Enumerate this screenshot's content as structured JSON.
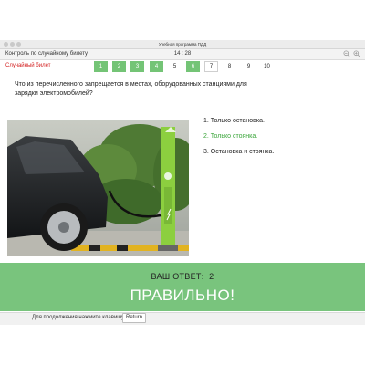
{
  "window": {
    "title": "Учебная программа ПДД"
  },
  "header": {
    "mode_title": "Контроль по случайному билету",
    "timer": "14 : 28"
  },
  "ticket": {
    "label": "Случайный билет",
    "questions": [
      {
        "number": "1",
        "state": "done"
      },
      {
        "number": "2",
        "state": "done"
      },
      {
        "number": "3",
        "state": "done"
      },
      {
        "number": "4",
        "state": "done"
      },
      {
        "number": "5",
        "state": "pending"
      },
      {
        "number": "6",
        "state": "done"
      },
      {
        "number": "7",
        "state": "current"
      },
      {
        "number": "8",
        "state": "pending"
      },
      {
        "number": "9",
        "state": "pending"
      },
      {
        "number": "10",
        "state": "pending"
      }
    ]
  },
  "question": {
    "text": "Что из перечисленного запрещается в местах, оборудованных станциями для зарядки электромобилей?"
  },
  "answers": [
    {
      "text": "1.  Только остановка.",
      "correct": false
    },
    {
      "text": "2.  Только стоянка.",
      "correct": true
    },
    {
      "text": "3.  Остановка и стоянка.",
      "correct": false
    }
  ],
  "result": {
    "your_answer_label": "ВАШ ОТВЕТ:",
    "your_answer_value": "2",
    "verdict": "ПРАВИЛЬНО!"
  },
  "footer": {
    "hint": "Для продолжения нажмите клавишу",
    "key": "Return",
    "ellipsis": "..."
  },
  "colors": {
    "accent_green": "#74c476",
    "banner_green": "#79c47d",
    "correct_text": "#3aa53a",
    "ticket_red": "#d32020"
  },
  "icons": {
    "zoom_out": "zoom-out-icon",
    "zoom_in": "zoom-in-icon"
  }
}
